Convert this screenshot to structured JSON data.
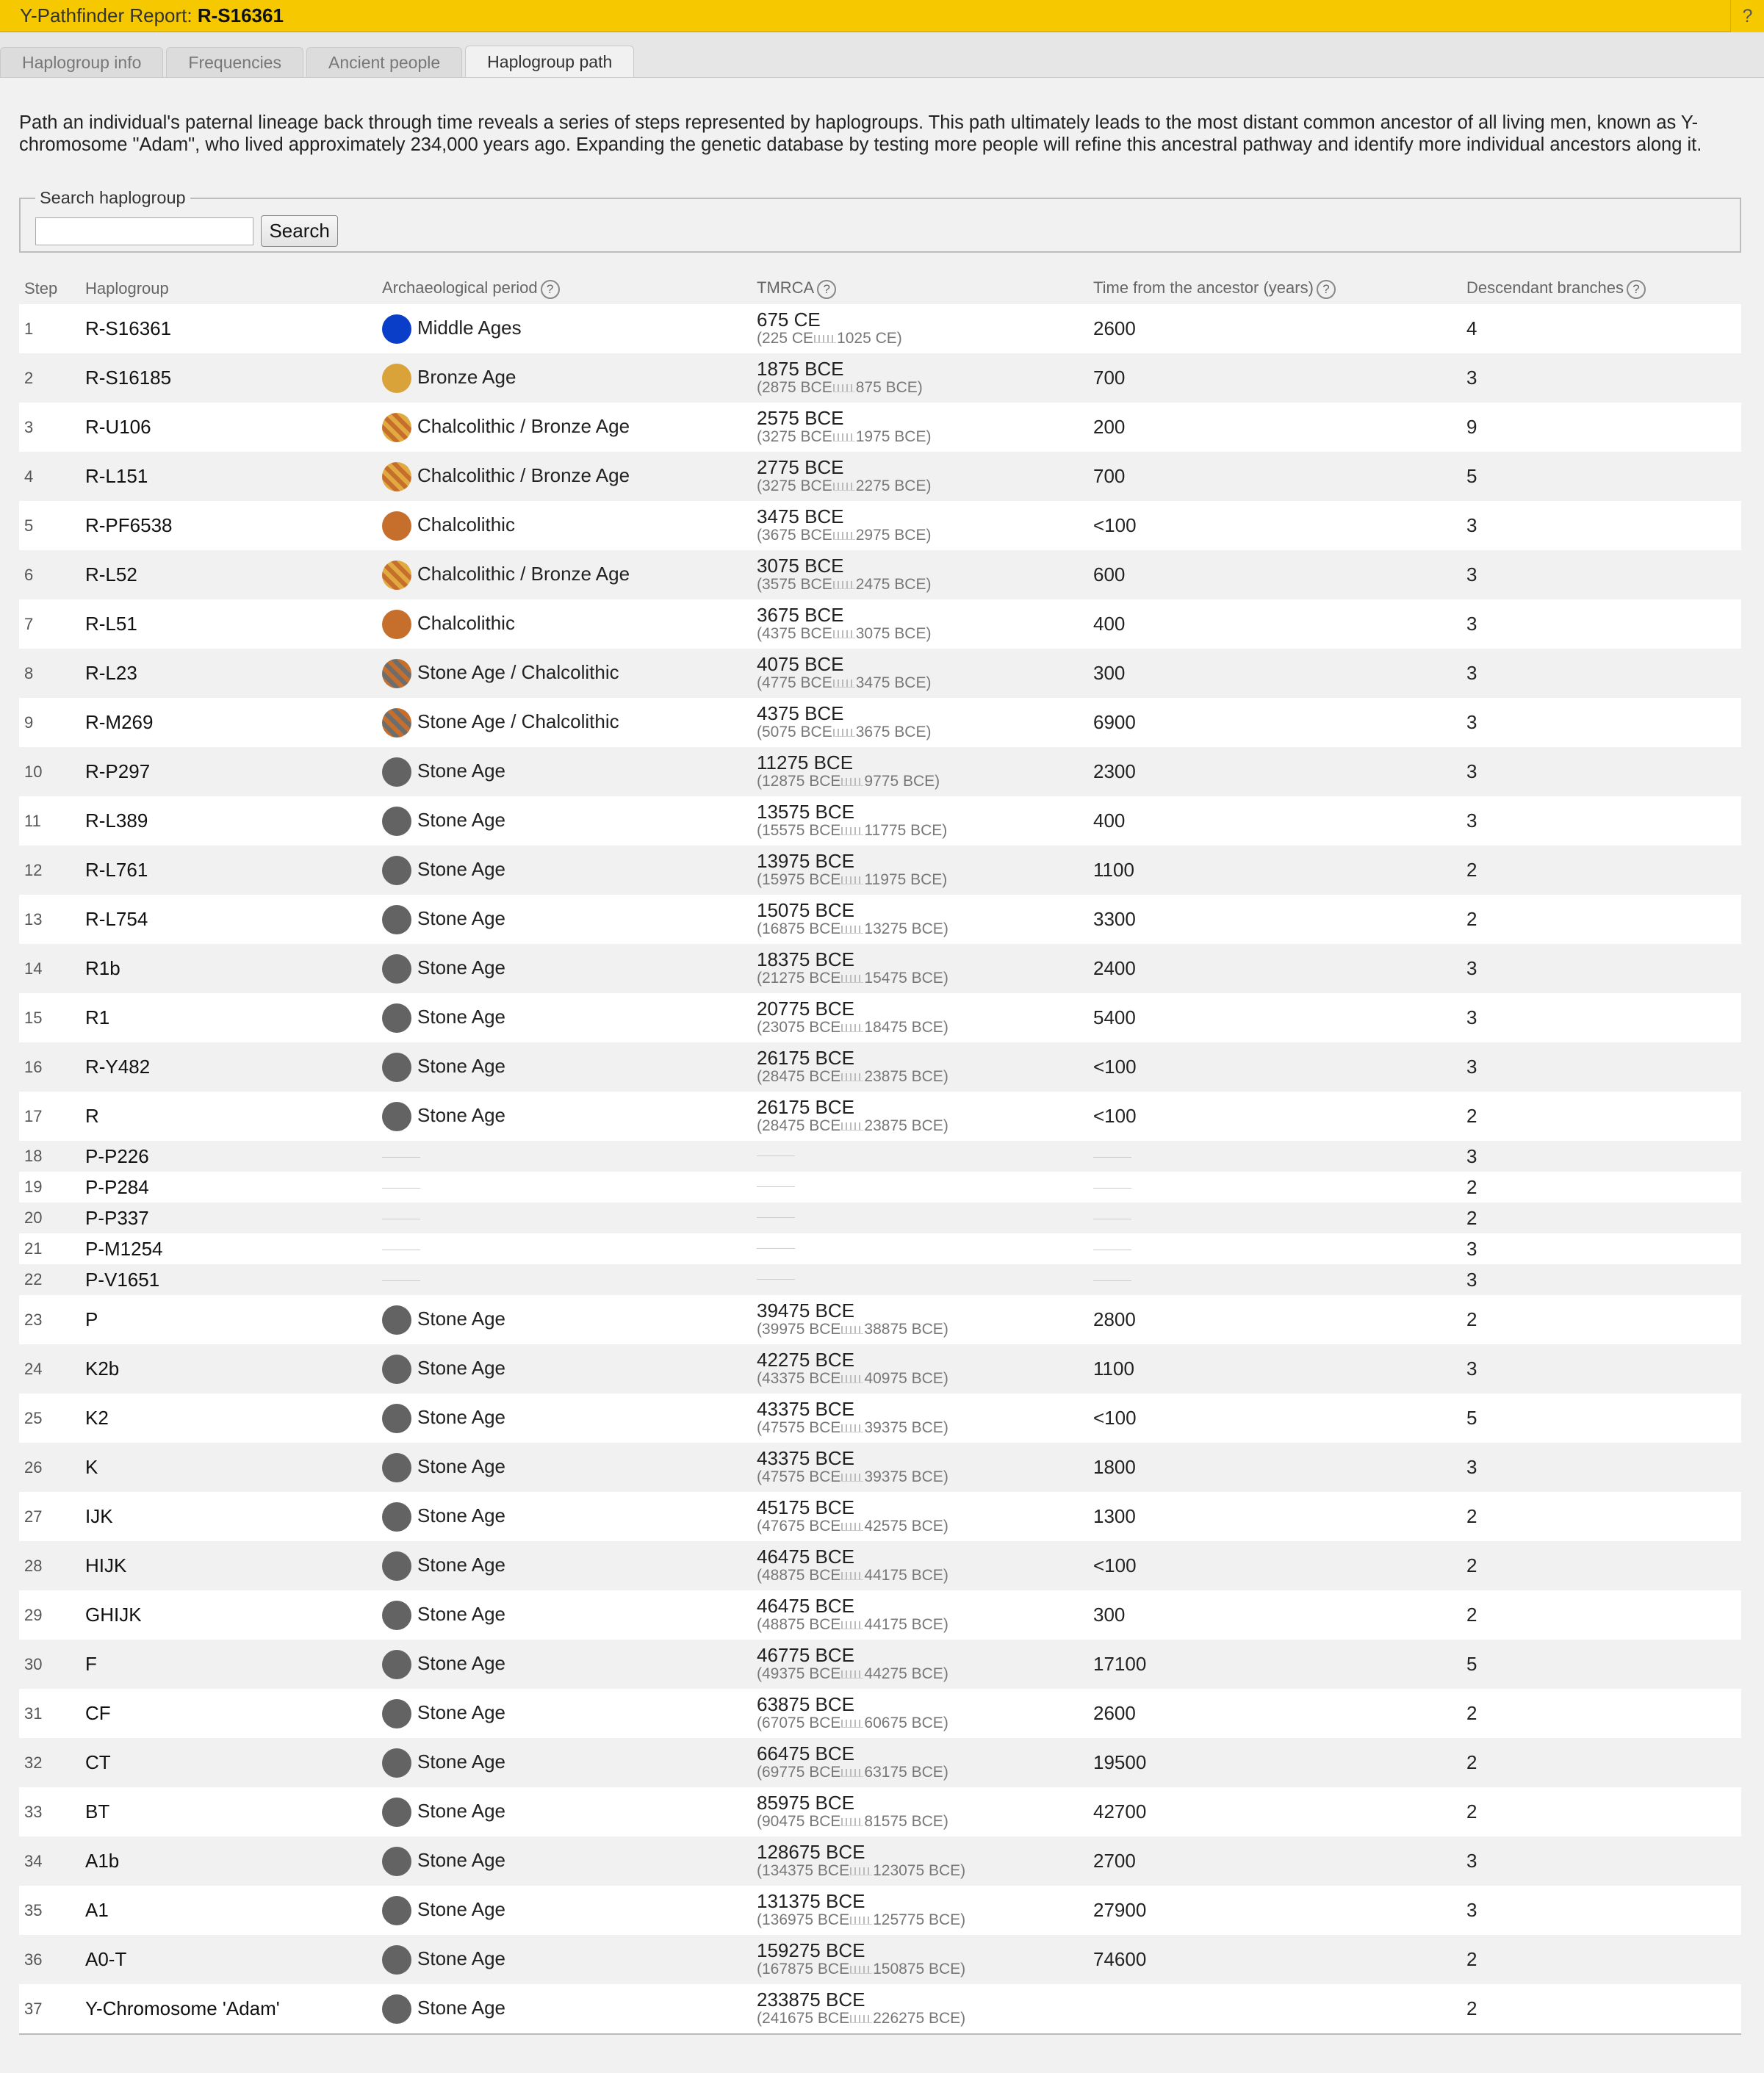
{
  "header": {
    "title_prefix": "Y-Pathfinder Report: ",
    "title_bold": "R-S16361",
    "help_label": "?"
  },
  "tabs": [
    {
      "label": "Haplogroup info"
    },
    {
      "label": "Frequencies"
    },
    {
      "label": "Ancient people"
    },
    {
      "label": "Haplogroup path",
      "active": true
    }
  ],
  "intro": "Path an individual's paternal lineage back through time reveals a series of steps represented by haplogroups. This path ultimately leads to the most distant common ancestor of all living men, known as Y-chromosome \"Adam\", who lived approximately 234,000 years ago. Expanding the genetic database by testing more people will refine this ancestral pathway and identify more individual ancestors along it.",
  "search": {
    "legend": "Search haplogroup",
    "value": "",
    "button": "Search"
  },
  "table": {
    "headers": {
      "step": "Step",
      "haplogroup": "Haplogroup",
      "period": "Archaeological period",
      "tmrca": "TMRCA",
      "years": "Time from the ancestor (years)",
      "desc": "Descendant branches"
    },
    "rows": [
      {
        "step": "1",
        "hg": "R-S16361",
        "period": "Middle Ages",
        "dot": "middle",
        "tmrca": "675 CE",
        "from": "(225 CE",
        "to": "1025 CE)",
        "years": "2600",
        "desc": "4"
      },
      {
        "step": "2",
        "hg": "R-S16185",
        "period": "Bronze Age",
        "dot": "bronze",
        "tmrca": "1875 BCE",
        "from": "(2875 BCE",
        "to": "875 BCE)",
        "years": "700",
        "desc": "3"
      },
      {
        "step": "3",
        "hg": "R-U106",
        "period": "Chalcolithic / Bronze Age",
        "dot": "chalbronze",
        "tmrca": "2575 BCE",
        "from": "(3275 BCE",
        "to": "1975 BCE)",
        "years": "200",
        "desc": "9"
      },
      {
        "step": "4",
        "hg": "R-L151",
        "period": "Chalcolithic / Bronze Age",
        "dot": "chalbronze",
        "tmrca": "2775 BCE",
        "from": "(3275 BCE",
        "to": "2275 BCE)",
        "years": "700",
        "desc": "5"
      },
      {
        "step": "5",
        "hg": "R-PF6538",
        "period": "Chalcolithic",
        "dot": "chalco",
        "tmrca": "3475 BCE",
        "from": "(3675 BCE",
        "to": "2975 BCE)",
        "years": "<100",
        "desc": "3"
      },
      {
        "step": "6",
        "hg": "R-L52",
        "period": "Chalcolithic / Bronze Age",
        "dot": "chalbronze",
        "tmrca": "3075 BCE",
        "from": "(3575 BCE",
        "to": "2475 BCE)",
        "years": "600",
        "desc": "3"
      },
      {
        "step": "7",
        "hg": "R-L51",
        "period": "Chalcolithic",
        "dot": "chalco",
        "tmrca": "3675 BCE",
        "from": "(4375 BCE",
        "to": "3075 BCE)",
        "years": "400",
        "desc": "3"
      },
      {
        "step": "8",
        "hg": "R-L23",
        "period": "Stone Age / Chalcolithic",
        "dot": "stonechal",
        "tmrca": "4075 BCE",
        "from": "(4775 BCE",
        "to": "3475 BCE)",
        "years": "300",
        "desc": "3"
      },
      {
        "step": "9",
        "hg": "R-M269",
        "period": "Stone Age / Chalcolithic",
        "dot": "stonechal",
        "tmrca": "4375 BCE",
        "from": "(5075 BCE",
        "to": "3675 BCE)",
        "years": "6900",
        "desc": "3"
      },
      {
        "step": "10",
        "hg": "R-P297",
        "period": "Stone Age",
        "dot": "stone",
        "tmrca": "11275 BCE",
        "from": "(12875 BCE",
        "to": "9775 BCE)",
        "years": "2300",
        "desc": "3"
      },
      {
        "step": "11",
        "hg": "R-L389",
        "period": "Stone Age",
        "dot": "stone",
        "tmrca": "13575 BCE",
        "from": "(15575 BCE",
        "to": "11775 BCE)",
        "years": "400",
        "desc": "3"
      },
      {
        "step": "12",
        "hg": "R-L761",
        "period": "Stone Age",
        "dot": "stone",
        "tmrca": "13975 BCE",
        "from": "(15975 BCE",
        "to": "11975 BCE)",
        "years": "1100",
        "desc": "2"
      },
      {
        "step": "13",
        "hg": "R-L754",
        "period": "Stone Age",
        "dot": "stone",
        "tmrca": "15075 BCE",
        "from": "(16875 BCE",
        "to": "13275 BCE)",
        "years": "3300",
        "desc": "2"
      },
      {
        "step": "14",
        "hg": "R1b",
        "period": "Stone Age",
        "dot": "stone",
        "tmrca": "18375 BCE",
        "from": "(21275 BCE",
        "to": "15475 BCE)",
        "years": "2400",
        "desc": "3"
      },
      {
        "step": "15",
        "hg": "R1",
        "period": "Stone Age",
        "dot": "stone",
        "tmrca": "20775 BCE",
        "from": "(23075 BCE",
        "to": "18475 BCE)",
        "years": "5400",
        "desc": "3"
      },
      {
        "step": "16",
        "hg": "R-Y482",
        "period": "Stone Age",
        "dot": "stone",
        "tmrca": "26175 BCE",
        "from": "(28475 BCE",
        "to": "23875 BCE)",
        "years": "<100",
        "desc": "3"
      },
      {
        "step": "17",
        "hg": "R",
        "period": "Stone Age",
        "dot": "stone",
        "tmrca": "26175 BCE",
        "from": "(28475 BCE",
        "to": "23875 BCE)",
        "years": "<100",
        "desc": "2"
      },
      {
        "step": "18",
        "hg": "P-P226",
        "empty": true,
        "desc": "3"
      },
      {
        "step": "19",
        "hg": "P-P284",
        "empty": true,
        "desc": "2"
      },
      {
        "step": "20",
        "hg": "P-P337",
        "empty": true,
        "desc": "2"
      },
      {
        "step": "21",
        "hg": "P-M1254",
        "empty": true,
        "desc": "3"
      },
      {
        "step": "22",
        "hg": "P-V1651",
        "empty": true,
        "desc": "3"
      },
      {
        "step": "23",
        "hg": "P",
        "period": "Stone Age",
        "dot": "stone",
        "tmrca": "39475 BCE",
        "from": "(39975 BCE",
        "to": "38875 BCE)",
        "years": "2800",
        "desc": "2"
      },
      {
        "step": "24",
        "hg": "K2b",
        "period": "Stone Age",
        "dot": "stone",
        "tmrca": "42275 BCE",
        "from": "(43375 BCE",
        "to": "40975 BCE)",
        "years": "1100",
        "desc": "3"
      },
      {
        "step": "25",
        "hg": "K2",
        "period": "Stone Age",
        "dot": "stone",
        "tmrca": "43375 BCE",
        "from": "(47575 BCE",
        "to": "39375 BCE)",
        "years": "<100",
        "desc": "5"
      },
      {
        "step": "26",
        "hg": "K",
        "period": "Stone Age",
        "dot": "stone",
        "tmrca": "43375 BCE",
        "from": "(47575 BCE",
        "to": "39375 BCE)",
        "years": "1800",
        "desc": "3"
      },
      {
        "step": "27",
        "hg": "IJK",
        "period": "Stone Age",
        "dot": "stone",
        "tmrca": "45175 BCE",
        "from": "(47675 BCE",
        "to": "42575 BCE)",
        "years": "1300",
        "desc": "2"
      },
      {
        "step": "28",
        "hg": "HIJK",
        "period": "Stone Age",
        "dot": "stone",
        "tmrca": "46475 BCE",
        "from": "(48875 BCE",
        "to": "44175 BCE)",
        "years": "<100",
        "desc": "2"
      },
      {
        "step": "29",
        "hg": "GHIJK",
        "period": "Stone Age",
        "dot": "stone",
        "tmrca": "46475 BCE",
        "from": "(48875 BCE",
        "to": "44175 BCE)",
        "years": "300",
        "desc": "2"
      },
      {
        "step": "30",
        "hg": "F",
        "period": "Stone Age",
        "dot": "stone",
        "tmrca": "46775 BCE",
        "from": "(49375 BCE",
        "to": "44275 BCE)",
        "years": "17100",
        "desc": "5"
      },
      {
        "step": "31",
        "hg": "CF",
        "period": "Stone Age",
        "dot": "stone",
        "tmrca": "63875 BCE",
        "from": "(67075 BCE",
        "to": "60675 BCE)",
        "years": "2600",
        "desc": "2"
      },
      {
        "step": "32",
        "hg": "CT",
        "period": "Stone Age",
        "dot": "stone",
        "tmrca": "66475 BCE",
        "from": "(69775 BCE",
        "to": "63175 BCE)",
        "years": "19500",
        "desc": "2"
      },
      {
        "step": "33",
        "hg": "BT",
        "period": "Stone Age",
        "dot": "stone",
        "tmrca": "85975 BCE",
        "from": "(90475 BCE",
        "to": "81575 BCE)",
        "years": "42700",
        "desc": "2"
      },
      {
        "step": "34",
        "hg": "A1b",
        "period": "Stone Age",
        "dot": "stone",
        "tmrca": "128675 BCE",
        "from": "(134375 BCE",
        "to": "123075 BCE)",
        "years": "2700",
        "desc": "3"
      },
      {
        "step": "35",
        "hg": "A1",
        "period": "Stone Age",
        "dot": "stone",
        "tmrca": "131375 BCE",
        "from": "(136975 BCE",
        "to": "125775 BCE)",
        "years": "27900",
        "desc": "3"
      },
      {
        "step": "36",
        "hg": "A0-T",
        "period": "Stone Age",
        "dot": "stone",
        "tmrca": "159275 BCE",
        "from": "(167875 BCE",
        "to": "150875 BCE)",
        "years": "74600",
        "desc": "2"
      },
      {
        "step": "37",
        "hg": "Y-Chromosome 'Adam'",
        "period": "Stone Age",
        "dot": "stone",
        "tmrca": "233875 BCE",
        "from": "(241675 BCE",
        "to": "226275 BCE)",
        "years": "",
        "desc": "2"
      }
    ]
  },
  "colors": {
    "topbar": "#f6c800",
    "middle_ages": "#0a3ec8",
    "bronze_age": "#d9a33a",
    "chalcolithic": "#c66f2c",
    "stone_age": "#636363"
  }
}
